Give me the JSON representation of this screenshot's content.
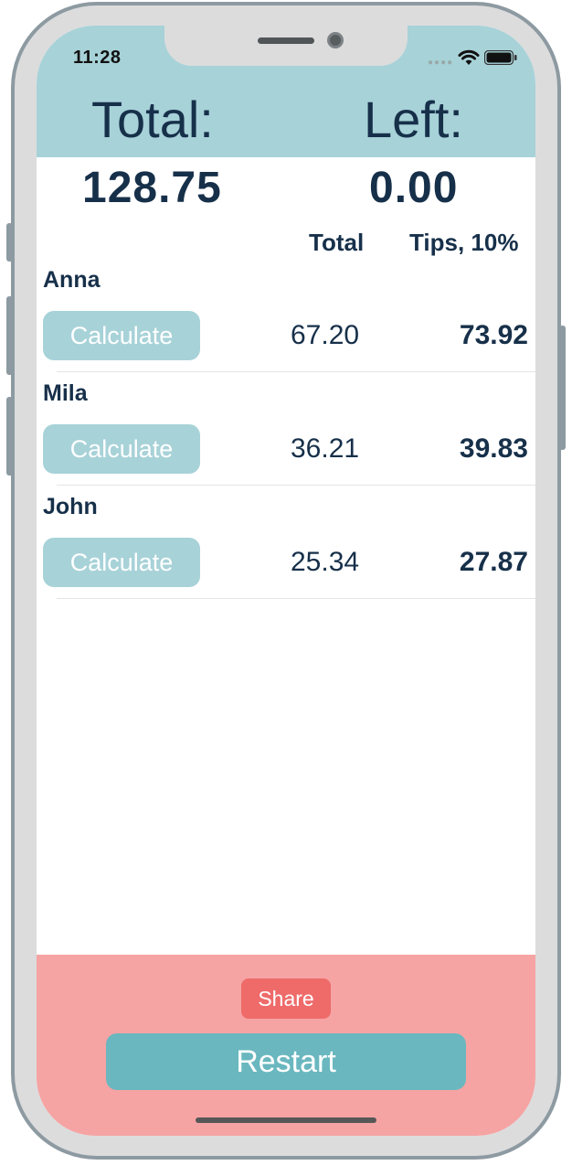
{
  "status_bar": {
    "time": "11:28"
  },
  "header": {
    "total_label": "Total:",
    "left_label": "Left:"
  },
  "summary": {
    "total_value": "128.75",
    "left_value": "0.00"
  },
  "columns": {
    "total": "Total",
    "tips": "Tips, 10%"
  },
  "people": [
    {
      "name": "Anna",
      "button": "Calculate",
      "total": "67.20",
      "tips": "73.92"
    },
    {
      "name": "Mila",
      "button": "Calculate",
      "total": "36.21",
      "tips": "39.83"
    },
    {
      "name": "John",
      "button": "Calculate",
      "total": "25.34",
      "tips": "27.87"
    }
  ],
  "footer": {
    "share_label": "Share",
    "restart_label": "Restart"
  },
  "colors": {
    "header_bg": "#a7d2d8",
    "text_dark": "#17304a",
    "footer_bg": "#f5a4a3",
    "share_bg": "#ee6b6a",
    "restart_bg": "#6ab7bf"
  },
  "icons": [
    "wifi-icon",
    "battery-icon",
    "signal-dots-icon"
  ]
}
